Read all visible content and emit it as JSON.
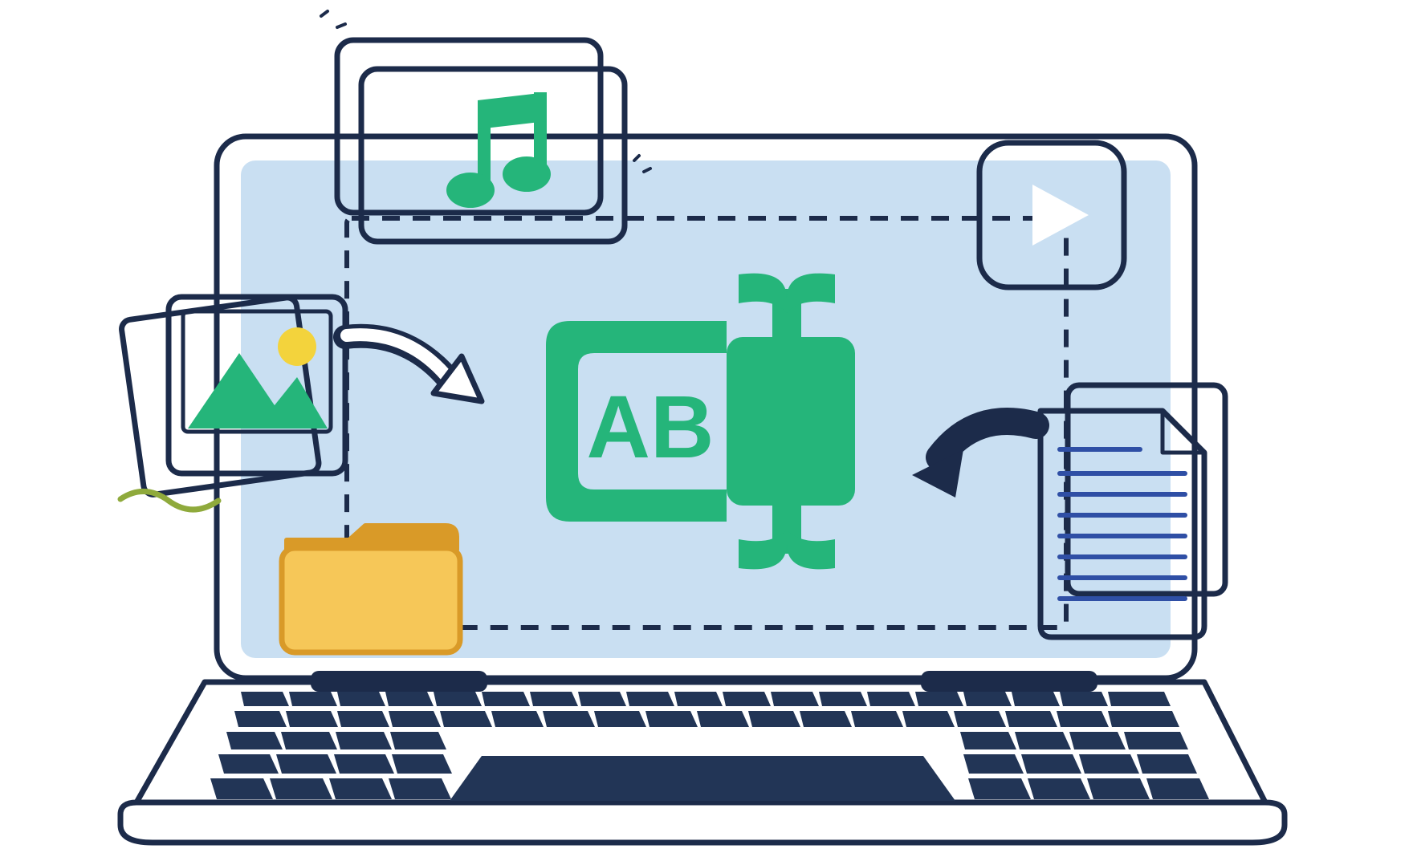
{
  "illustration": {
    "description": "Flat-style illustration of a laptop with a dashed dropzone on the screen. A green renaming/text-cursor glyph labeled 'AB' sits in the center. Floating around the laptop are file-type cards: a stacked photo card, a music-note card, a green play-button app tile, a folder, and a stacked text-document card. Curved arrows point from the photo card and the document card toward the center.",
    "center_label": "AB",
    "colors": {
      "outline": "#1C2B4A",
      "green": "#25B57A",
      "green_dark": "#1E9965",
      "screen": "#C9DFF2",
      "panel": "#E6ECF2",
      "folder": "#F6C758",
      "folder_stroke": "#D99A28",
      "sun": "#F3D33C",
      "doc_line": "#2F4FA5",
      "key": "#223556"
    },
    "items": [
      {
        "name": "photo-card",
        "meaning": "image files (stacked photos with mountains and sun)"
      },
      {
        "name": "music-card",
        "meaning": "audio files (stacked cards with music note)"
      },
      {
        "name": "play-tile",
        "meaning": "video files (rounded green tile with play triangle)"
      },
      {
        "name": "folder-card",
        "meaning": "folder"
      },
      {
        "name": "document-card",
        "meaning": "text document (stacked pages with lines and folded corner)"
      },
      {
        "name": "arrow-left",
        "meaning": "arrow from photos toward center"
      },
      {
        "name": "arrow-right",
        "meaning": "arrow from documents toward center"
      },
      {
        "name": "dropzone",
        "meaning": "dashed rectangle dropzone on laptop screen"
      },
      {
        "name": "rename-glyph",
        "meaning": "green 'AB' text-field / rename icon with I-beam cursor"
      }
    ]
  }
}
